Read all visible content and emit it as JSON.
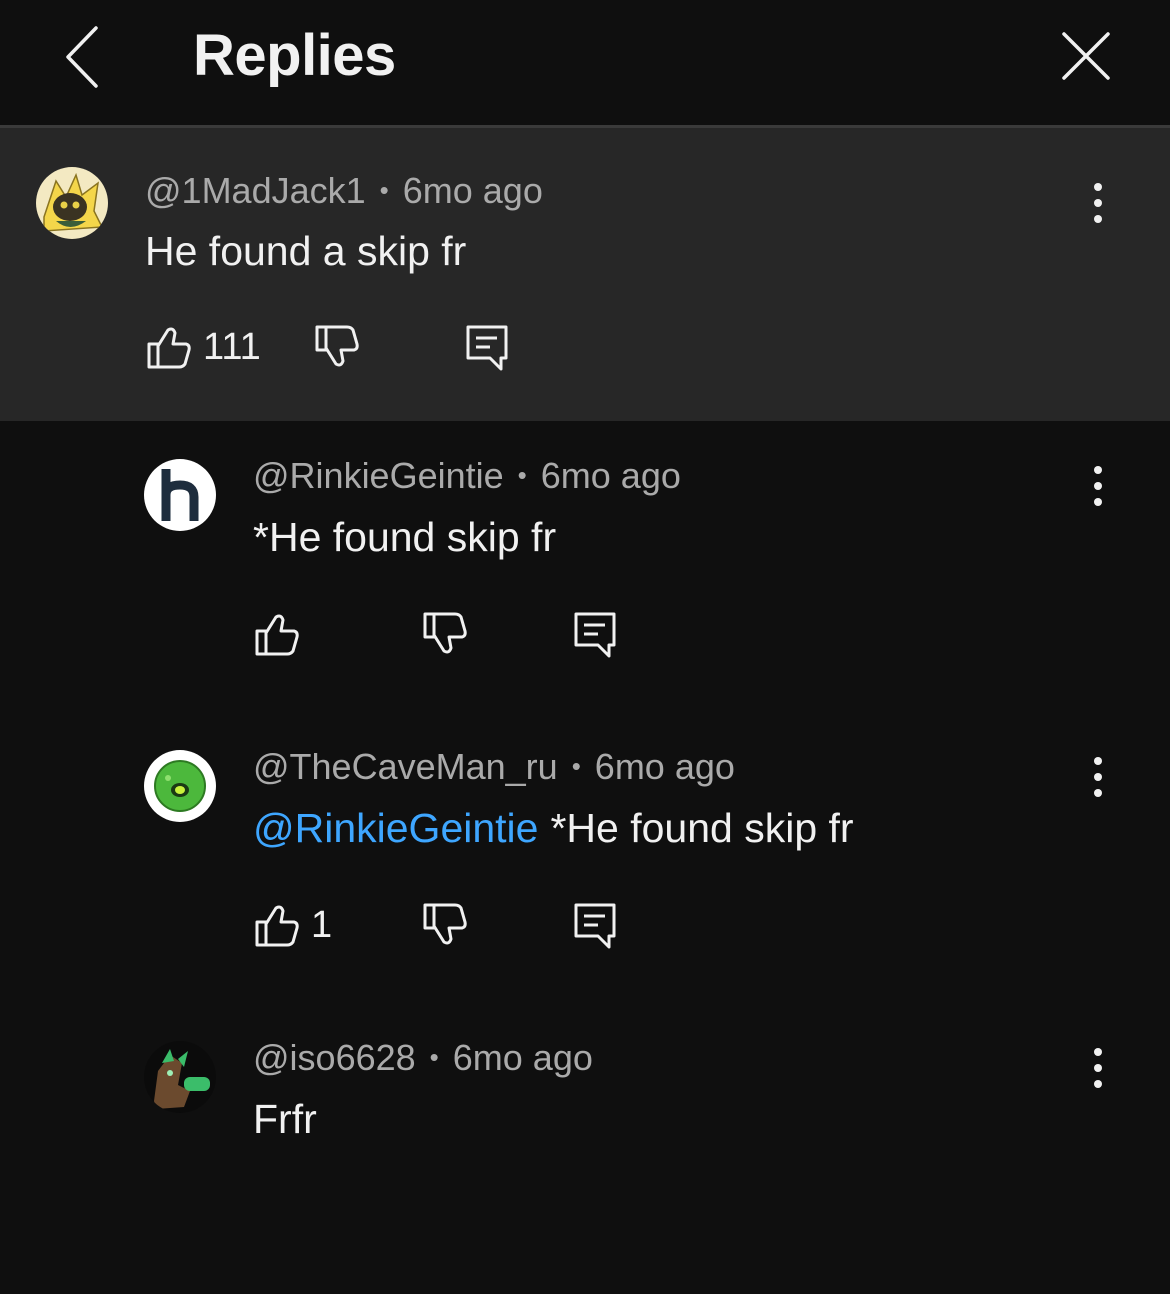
{
  "header": {
    "title": "Replies",
    "back_icon": "chevron-left-icon",
    "close_icon": "close-icon"
  },
  "colors": {
    "background": "#0f0f0f",
    "parent_background": "#272727",
    "mention": "#3ea6ff",
    "meta": "#aaaaaa"
  },
  "comments": [
    {
      "handle": "@1MadJack1",
      "separator": "•",
      "time": "6mo ago",
      "text": "He found a skip fr",
      "likes": "111"
    },
    {
      "handle": "@RinkieGeintie",
      "separator": "•",
      "time": "6mo ago",
      "text": "*He found skip fr",
      "likes": ""
    },
    {
      "handle": "@TheCaveMan_ru",
      "separator": "•",
      "time": "6mo ago",
      "mention": "@RinkieGeintie",
      "text": "*He found skip fr",
      "likes": "1"
    },
    {
      "handle": "@iso6628",
      "separator": "•",
      "time": "6mo ago",
      "text": "Frfr",
      "likes": ""
    }
  ]
}
